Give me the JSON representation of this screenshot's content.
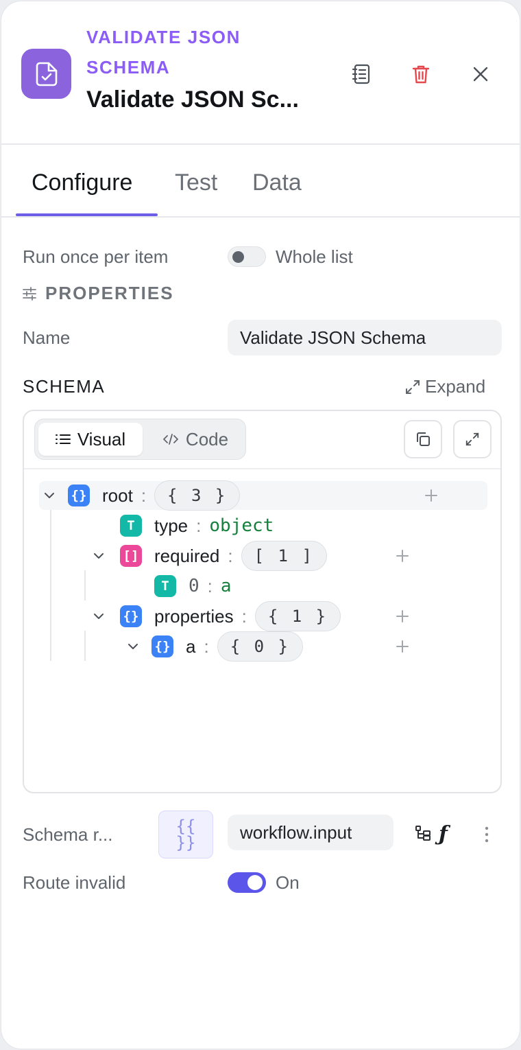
{
  "header": {
    "kicker": "VALIDATE JSON SCHEMA",
    "title": "Validate JSON Sc..."
  },
  "tabs": [
    {
      "label": "Configure",
      "active": true
    },
    {
      "label": "Test",
      "active": false
    },
    {
      "label": "Data",
      "active": false
    }
  ],
  "run_mode": {
    "label": "Run once per item",
    "toggle_label": "Whole list",
    "enabled": false
  },
  "properties": {
    "heading": "PROPERTIES",
    "name_label": "Name",
    "name_value": "Validate JSON Schema"
  },
  "schema": {
    "label": "SCHEMA",
    "expand_label": "Expand",
    "view_visual": "Visual",
    "view_code": "Code",
    "tree": {
      "root_key": "root",
      "root_summary": "{ 3 }",
      "type_key": "type",
      "type_value": "object",
      "required_key": "required",
      "required_summary": "[ 1 ]",
      "required_index": "0",
      "required_value": "a",
      "properties_key": "properties",
      "properties_summary": "{ 1 }",
      "prop_a_key": "a",
      "prop_a_summary": "{ 0 }"
    }
  },
  "schema_source": {
    "label": "Schema r...",
    "template_glyph": "{{ }}",
    "value": "workflow.input"
  },
  "route_invalid": {
    "label": "Route invalid",
    "toggle_label": "On",
    "enabled": true
  },
  "colors": {
    "accent": "#5b55ea",
    "kicker": "#8b5cf6",
    "node_icon": "#8b63dd",
    "delete": "#e5484d",
    "object_badge": "#3b82f6",
    "array_badge": "#ec4899",
    "string_badge": "#14b8a6",
    "string_value": "#16803c"
  }
}
